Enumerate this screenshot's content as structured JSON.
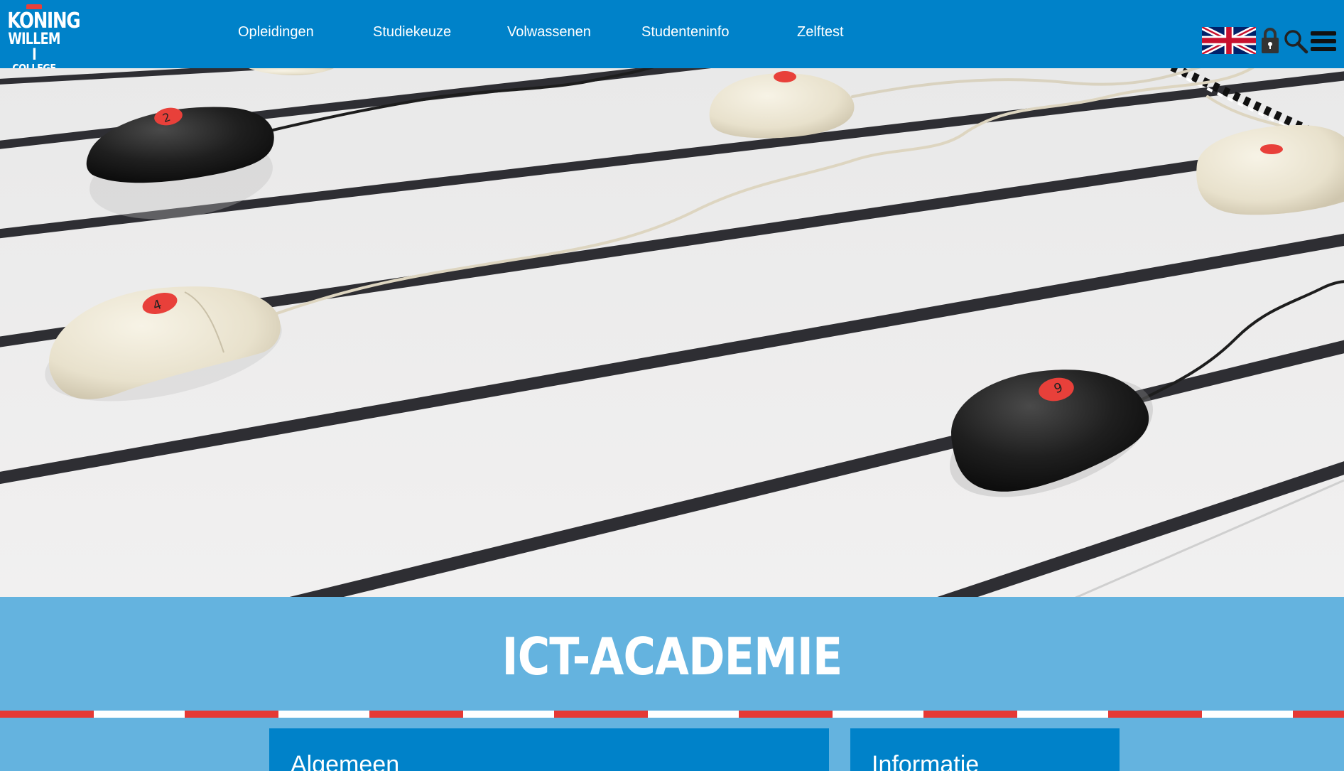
{
  "header": {
    "logo": {
      "line1": "KONING",
      "line2": "WILLEM I",
      "line3": "COLLEGE"
    },
    "nav": [
      {
        "label": "Opleidingen"
      },
      {
        "label": "Studiekeuze"
      },
      {
        "label": "Volwassenen"
      },
      {
        "label": "Studenteninfo"
      },
      {
        "label": "Zelftest"
      }
    ],
    "icons": [
      "uk-flag-icon",
      "lock-icon",
      "search-icon",
      "hamburger-menu-icon"
    ]
  },
  "page": {
    "title": "ICT-ACADEMIE"
  },
  "cards": [
    {
      "title": "Algemeen"
    },
    {
      "title": "Informatie"
    }
  ],
  "colors": {
    "header_blue": "#0082c9",
    "band_light_blue": "#64b3df",
    "stripe_red": "#e53935",
    "mouse_label_red": "#e8403a"
  }
}
